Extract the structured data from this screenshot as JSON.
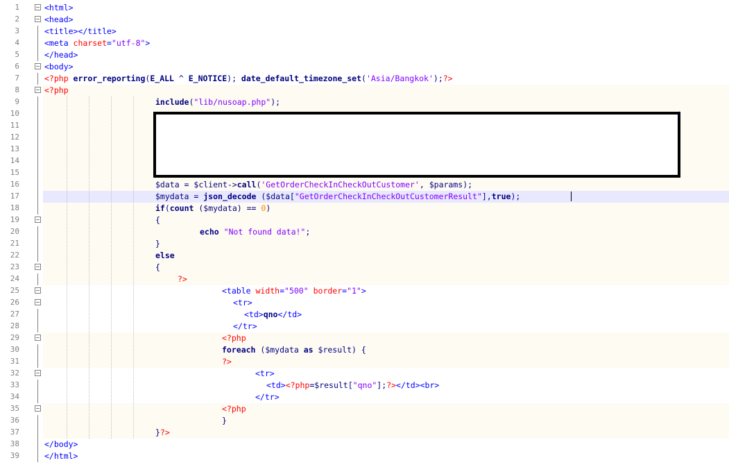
{
  "lines": [
    {
      "n": "1",
      "tokens": [
        [
          "tag",
          "<html>"
        ]
      ]
    },
    {
      "n": "2",
      "tokens": [
        [
          "tag",
          "<head>"
        ]
      ]
    },
    {
      "n": "3",
      "tokens": [
        [
          "tag",
          "<title></title>"
        ]
      ]
    },
    {
      "n": "4",
      "tokens": [
        [
          "tag",
          "<meta "
        ],
        [
          "attr",
          "charset"
        ],
        [
          "tag",
          "="
        ],
        [
          "str",
          "\"utf-8\""
        ],
        [
          "tag",
          ">"
        ]
      ]
    },
    {
      "n": "5",
      "tokens": [
        [
          "tag",
          "</head>"
        ]
      ]
    },
    {
      "n": "6",
      "tokens": [
        [
          "tag",
          "<body>"
        ]
      ]
    },
    {
      "n": "7",
      "tokens": [
        [
          "phpt",
          "<?php "
        ],
        [
          "kw",
          "error_reporting"
        ],
        [
          "plain",
          "("
        ],
        [
          "kw",
          "E_ALL"
        ],
        [
          "plain",
          " ^ "
        ],
        [
          "kw",
          "E_NOTICE"
        ],
        [
          "plain",
          "); "
        ],
        [
          "kw",
          "date_default_timezone_set"
        ],
        [
          "plain",
          "("
        ],
        [
          "str",
          "'Asia/Bangkok'"
        ],
        [
          "plain",
          ");"
        ],
        [
          "phpt",
          "?>"
        ]
      ]
    },
    {
      "n": "8",
      "tokens": [
        [
          "phpt",
          "<?php"
        ]
      ]
    },
    {
      "n": "9",
      "tokens": [
        [
          "kw",
          "include"
        ],
        [
          "plain",
          "("
        ],
        [
          "str",
          "\"lib/nusoap.php\""
        ],
        [
          "plain",
          ");"
        ]
      ]
    },
    {
      "n": "10",
      "tokens": []
    },
    {
      "n": "11",
      "tokens": []
    },
    {
      "n": "12",
      "tokens": []
    },
    {
      "n": "13",
      "tokens": []
    },
    {
      "n": "14",
      "tokens": []
    },
    {
      "n": "15",
      "tokens": []
    },
    {
      "n": "16",
      "tokens": [
        [
          "var",
          "$data"
        ],
        [
          "plain",
          " = "
        ],
        [
          "var",
          "$client"
        ],
        [
          "plain",
          "->"
        ],
        [
          "kw",
          "call"
        ],
        [
          "plain",
          "("
        ],
        [
          "str",
          "'GetOrderCheckInCheckOutCustomer'"
        ],
        [
          "plain",
          ", "
        ],
        [
          "var",
          "$params"
        ],
        [
          "plain",
          ");"
        ]
      ]
    },
    {
      "n": "17",
      "tokens": [
        [
          "var",
          "$mydata"
        ],
        [
          "plain",
          " = "
        ],
        [
          "kw",
          "json_decode"
        ],
        [
          "plain",
          " ("
        ],
        [
          "var",
          "$data"
        ],
        [
          "plain",
          "["
        ],
        [
          "str",
          "\"GetOrderCheckInCheckOutCustomerResult\""
        ],
        [
          "plain",
          "],"
        ],
        [
          "kw",
          "true"
        ],
        [
          "plain",
          ");"
        ]
      ]
    },
    {
      "n": "18",
      "tokens": [
        [
          "kw",
          "if"
        ],
        [
          "plain",
          "("
        ],
        [
          "kw",
          "count"
        ],
        [
          "plain",
          " ("
        ],
        [
          "var",
          "$mydata"
        ],
        [
          "plain",
          ") == "
        ],
        [
          "num",
          "0"
        ],
        [
          "plain",
          ")"
        ]
      ]
    },
    {
      "n": "19",
      "tokens": [
        [
          "plain",
          "{"
        ]
      ]
    },
    {
      "n": "20",
      "tokens": [
        [
          "kw",
          "echo"
        ],
        [
          "plain",
          " "
        ],
        [
          "str",
          "\"Not found data!\""
        ],
        [
          "plain",
          ";"
        ]
      ]
    },
    {
      "n": "21",
      "tokens": [
        [
          "plain",
          "}"
        ]
      ]
    },
    {
      "n": "22",
      "tokens": [
        [
          "kw",
          "else"
        ]
      ]
    },
    {
      "n": "23",
      "tokens": [
        [
          "plain",
          "{"
        ]
      ]
    },
    {
      "n": "24",
      "tokens": [
        [
          "phpt",
          "?>"
        ]
      ]
    },
    {
      "n": "25",
      "tokens": [
        [
          "tag",
          "<table "
        ],
        [
          "attr",
          "width"
        ],
        [
          "tag",
          "="
        ],
        [
          "str",
          "\"500\""
        ],
        [
          "tag",
          " "
        ],
        [
          "attr",
          "border"
        ],
        [
          "tag",
          "="
        ],
        [
          "str",
          "\"1\""
        ],
        [
          "tag",
          ">"
        ]
      ]
    },
    {
      "n": "26",
      "tokens": [
        [
          "tag",
          "<tr>"
        ]
      ]
    },
    {
      "n": "27",
      "tokens": [
        [
          "tag",
          "<td>"
        ],
        [
          "kw",
          "qno"
        ],
        [
          "tag",
          "</td>"
        ]
      ]
    },
    {
      "n": "28",
      "tokens": [
        [
          "tag",
          "</tr>"
        ]
      ]
    },
    {
      "n": "29",
      "tokens": [
        [
          "phpt",
          "<?php"
        ]
      ]
    },
    {
      "n": "30",
      "tokens": [
        [
          "kw",
          "foreach"
        ],
        [
          "plain",
          " ("
        ],
        [
          "var",
          "$mydata"
        ],
        [
          "plain",
          " "
        ],
        [
          "kw",
          "as"
        ],
        [
          "plain",
          " "
        ],
        [
          "var",
          "$result"
        ],
        [
          "plain",
          ") {"
        ]
      ]
    },
    {
      "n": "31",
      "tokens": [
        [
          "phpt",
          "?>"
        ]
      ]
    },
    {
      "n": "32",
      "tokens": [
        [
          "tag",
          "<tr>"
        ]
      ]
    },
    {
      "n": "33",
      "tokens": [
        [
          "tag",
          "<td>"
        ],
        [
          "phpt",
          "<?php"
        ],
        [
          "plain",
          "="
        ],
        [
          "var",
          "$result"
        ],
        [
          "plain",
          "["
        ],
        [
          "str",
          "\"qno\""
        ],
        [
          "plain",
          "];"
        ],
        [
          "phpt",
          "?>"
        ],
        [
          "tag",
          "</td><br>"
        ]
      ]
    },
    {
      "n": "34",
      "tokens": [
        [
          "tag",
          "</tr>"
        ]
      ]
    },
    {
      "n": "35",
      "tokens": [
        [
          "phpt",
          "<?php"
        ]
      ]
    },
    {
      "n": "36",
      "tokens": [
        [
          "plain",
          "}"
        ]
      ]
    },
    {
      "n": "37",
      "tokens": [
        [
          "plain",
          "}"
        ],
        [
          "phpt",
          "?>"
        ]
      ]
    },
    {
      "n": "38",
      "tokens": [
        [
          "tag",
          "</body>"
        ]
      ]
    },
    {
      "n": "39",
      "tokens": [
        [
          "tag",
          "</html>"
        ]
      ]
    }
  ],
  "line10_tail": ";"
}
